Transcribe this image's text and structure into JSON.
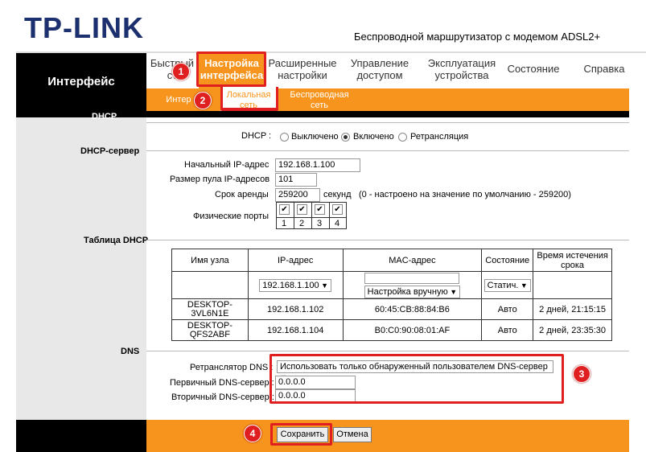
{
  "header": {
    "logo": "TP-LINK",
    "product": "Беспроводной маршрутизатор с модемом ADSL2+"
  },
  "sidebar": {
    "title": "Интерфейс"
  },
  "menu": {
    "items": [
      {
        "label1": "Быстрый",
        "label2": "ст"
      },
      {
        "label1": "Настройка",
        "label2": "интерфейса"
      },
      {
        "label1": "Расширенные",
        "label2": "настройки"
      },
      {
        "label1": "Управление",
        "label2": "доступом"
      },
      {
        "label1": "Эксплуатация",
        "label2": "устройства"
      },
      {
        "label1": "Состояние",
        "label2": ""
      },
      {
        "label1": "Справка",
        "label2": ""
      }
    ]
  },
  "submenu": {
    "items": [
      {
        "label1": "Интер",
        "label2": ""
      },
      {
        "label1": "Локальная",
        "label2": "сеть"
      },
      {
        "label1": "Беспроводная",
        "label2": "сеть"
      }
    ]
  },
  "dhcp": {
    "section": "DHCP",
    "label": "DHCP :",
    "options": [
      "Выключено",
      "Включено",
      "Ретрансляция"
    ],
    "selected": "Включено"
  },
  "dhcp_server": {
    "section": "DHCP-сервер",
    "start_ip_label": "Начальный IP-адрес",
    "start_ip": "192.168.1.100",
    "pool_label": "Размер пула IP-адресов",
    "pool": "101",
    "lease_label": "Срок аренды",
    "lease": "259200",
    "lease_unit": "секунд",
    "lease_note": "(0 - настроено на значение по умолчанию - 259200)",
    "ports_label": "Физические порты",
    "ports": [
      "1",
      "2",
      "3",
      "4"
    ]
  },
  "table": {
    "section": "Таблица DHCP",
    "headers": [
      "Имя узла",
      "IP-адрес",
      "MAC-адрес",
      "Состояние",
      "Время истечения срока"
    ],
    "new_row": {
      "ip": "192.168.1.100",
      "mac_mode": "Настройка вручную",
      "state": "Статич."
    },
    "rows": [
      {
        "host1": "DESKTOP-",
        "host2": "3VL6N1E",
        "ip": "192.168.1.102",
        "mac": "60:45:CB:88:84:B6",
        "state": "Авто",
        "expire": "2 дней, 21:15:15"
      },
      {
        "host1": "DESKTOP-",
        "host2": "QFS2ABF",
        "ip": "192.168.1.104",
        "mac": "B0:C0:90:08:01:AF",
        "state": "Авто",
        "expire": "2 дней, 23:35:30"
      }
    ]
  },
  "dns": {
    "section": "DNS",
    "relay_label": "Ретранслятор DNS :",
    "relay_value": "Использовать только обнаруженный пользователем DNS-сервер",
    "primary_label": "Первичный DNS-сервер :",
    "primary": "0.0.0.0",
    "secondary_label": "Вторичный DNS-сервер :",
    "secondary": "0.0.0.0"
  },
  "actions": {
    "save": "Сохранить",
    "cancel": "Отмена"
  },
  "badges": [
    "1",
    "2",
    "3",
    "4"
  ],
  "colors": {
    "accent": "#f7941d",
    "annotation": "#e02020",
    "brand": "#1c2f6e"
  }
}
